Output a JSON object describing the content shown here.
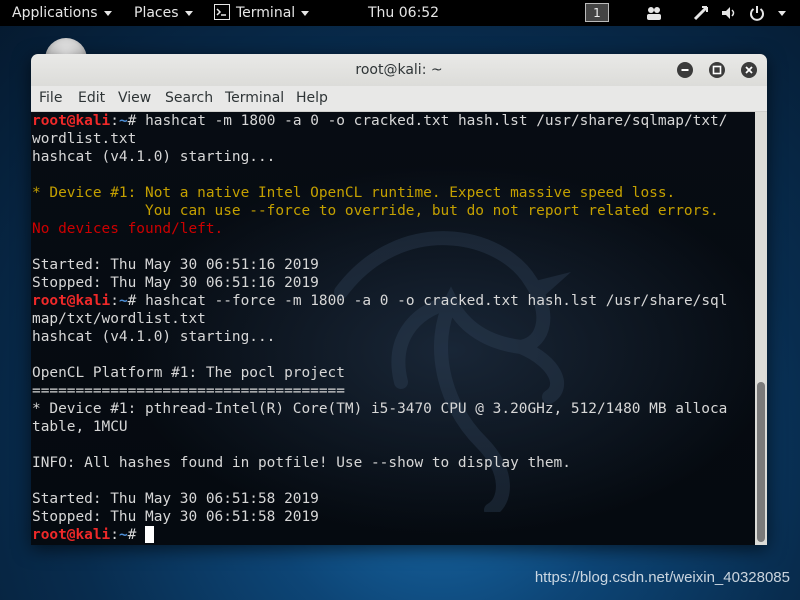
{
  "top_panel": {
    "applications": "Applications",
    "places": "Places",
    "terminal": "Terminal",
    "clock": "Thu 06:52",
    "workspace": "1"
  },
  "window": {
    "title": "root@kali: ~",
    "menu": [
      "File",
      "Edit",
      "View",
      "Search",
      "Terminal",
      "Help"
    ]
  },
  "terminal": {
    "prompt": {
      "user": "root",
      "at": "@",
      "host": "kali",
      "sep": ":",
      "path": "~",
      "symbol": "# "
    },
    "lines": [
      {
        "type": "cmd",
        "text": "hashcat -m 1800 -a 0 -o cracked.txt hash.lst /usr/share/sqlmap/txt/"
      },
      {
        "type": "out",
        "text": "wordlist.txt"
      },
      {
        "type": "out",
        "text": "hashcat (v4.1.0) starting..."
      },
      {
        "type": "blank",
        "text": ""
      },
      {
        "type": "warn",
        "text": "* Device #1: Not a native Intel OpenCL runtime. Expect massive speed loss."
      },
      {
        "type": "warn",
        "text": "             You can use --force to override, but do not report related errors."
      },
      {
        "type": "err",
        "text": "No devices found/left."
      },
      {
        "type": "blank",
        "text": ""
      },
      {
        "type": "out",
        "text": "Started: Thu May 30 06:51:16 2019"
      },
      {
        "type": "out",
        "text": "Stopped: Thu May 30 06:51:16 2019"
      },
      {
        "type": "cmd",
        "text": "hashcat --force -m 1800 -a 0 -o cracked.txt hash.lst /usr/share/sql"
      },
      {
        "type": "out",
        "text": "map/txt/wordlist.txt"
      },
      {
        "type": "out",
        "text": "hashcat (v4.1.0) starting..."
      },
      {
        "type": "blank",
        "text": ""
      },
      {
        "type": "out",
        "text": "OpenCL Platform #1: The pocl project"
      },
      {
        "type": "out",
        "text": "===================================="
      },
      {
        "type": "out",
        "text": "* Device #1: pthread-Intel(R) Core(TM) i5-3470 CPU @ 3.20GHz, 512/1480 MB alloca"
      },
      {
        "type": "out",
        "text": "table, 1MCU"
      },
      {
        "type": "blank",
        "text": ""
      },
      {
        "type": "out",
        "text": "INFO: All hashes found in potfile! Use --show to display them."
      },
      {
        "type": "blank",
        "text": ""
      },
      {
        "type": "out",
        "text": "Started: Thu May 30 06:51:58 2019"
      },
      {
        "type": "out",
        "text": "Stopped: Thu May 30 06:51:58 2019"
      },
      {
        "type": "prompt",
        "text": ""
      }
    ]
  },
  "watermark": "https://blog.csdn.net/weixin_40328085",
  "colors": {
    "prompt_red": "#ef2929",
    "path_blue": "#4f8fd6",
    "warning": "#c4a000",
    "error": "#cc0000"
  },
  "icons": [
    "terminal-icon",
    "people-icon",
    "network-icon",
    "volume-icon",
    "power-icon",
    "minimize-icon",
    "maximize-icon",
    "close-icon"
  ]
}
